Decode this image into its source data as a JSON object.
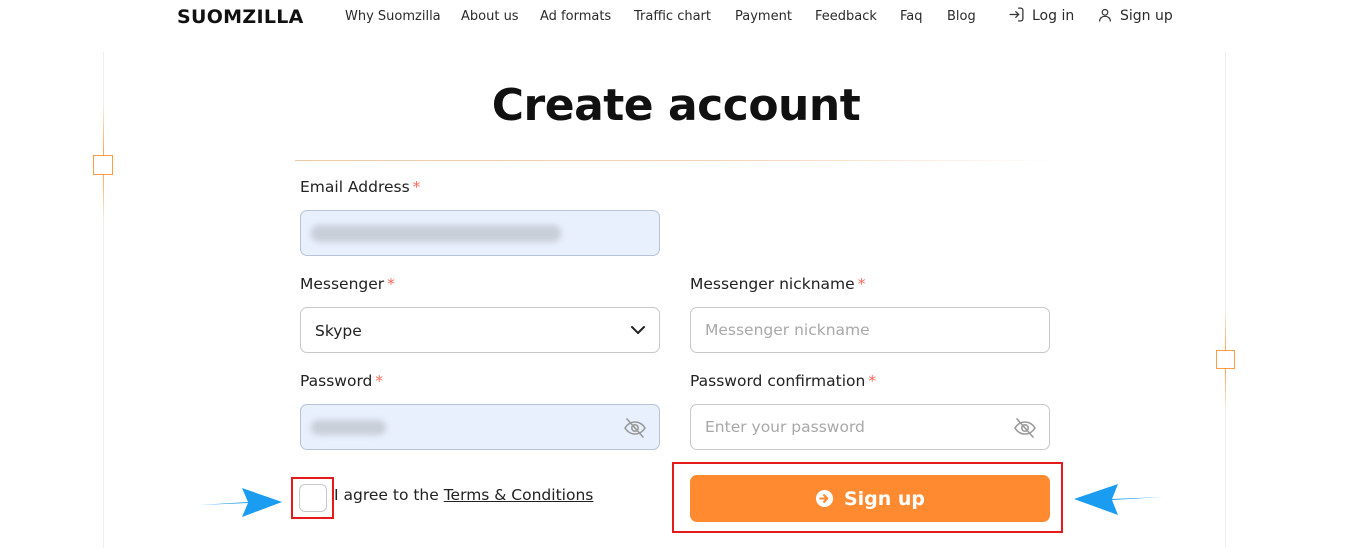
{
  "header": {
    "logo": "SUOMZILLA",
    "nav": [
      "Why Suomzilla",
      "About us",
      "Ad formats",
      "Traffic chart",
      "Payment",
      "Feedback",
      "Faq",
      "Blog"
    ],
    "login": "Log in",
    "signup": "Sign up"
  },
  "form": {
    "title": "Create account",
    "required_mark": "*",
    "email": {
      "label": "Email Address",
      "value": ""
    },
    "messenger": {
      "label": "Messenger",
      "value": "Skype"
    },
    "nickname": {
      "label": "Messenger nickname",
      "placeholder": "Messenger nickname",
      "value": ""
    },
    "password": {
      "label": "Password",
      "value": ""
    },
    "password_confirmation": {
      "label": "Password confirmation",
      "placeholder": "Enter your password",
      "value": ""
    },
    "agree_prefix": "I agree to the ",
    "terms_link": "Terms & Conditions",
    "agree_checked": false,
    "submit": "Sign up"
  },
  "colors": {
    "accent": "#ff8a30",
    "highlight": "#e51b1b",
    "annotation_arrow": "#1a9cf0",
    "autofill": "#e8effd"
  }
}
